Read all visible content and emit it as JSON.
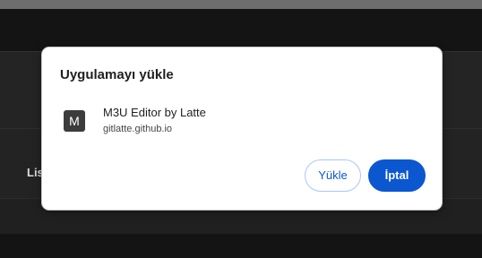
{
  "background": {
    "partial_text": "List"
  },
  "dialog": {
    "title": "Uygulamayı yükle",
    "app": {
      "icon_letter": "M",
      "icon_name": "app-letter-icon",
      "name": "M3U Editor by Latte",
      "origin": "gitlatte.github.io"
    },
    "buttons": {
      "install_label": "Yükle",
      "cancel_label": "İptal"
    }
  },
  "colors": {
    "accent": "#0b57d0",
    "dialog_background": "#ffffff",
    "page_background": "#1f1f1f"
  }
}
